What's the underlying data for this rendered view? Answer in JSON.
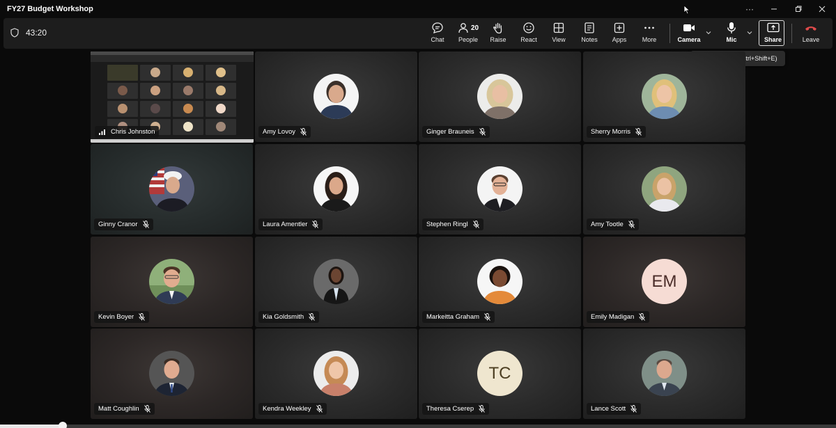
{
  "window": {
    "title": "FY27 Budget Workshop"
  },
  "toolbar": {
    "timer": "43:20",
    "chat_label": "Chat",
    "people_label": "People",
    "people_count": "20",
    "raise_label": "Raise",
    "react_label": "React",
    "view_label": "View",
    "notes_label": "Notes",
    "apps_label": "Apps",
    "more_label": "More",
    "camera_label": "Camera",
    "mic_label": "Mic",
    "share_label": "Share",
    "leave_label": "Leave",
    "leave_color": "#e04b4b"
  },
  "tooltip": {
    "text": "Share content (Ctrl+Shift+E)"
  },
  "shared_screen": {
    "presenter": "Chris Johnston"
  },
  "participants": [
    {
      "name": "Amy Lovoy"
    },
    {
      "name": "Ginger Brauneis"
    },
    {
      "name": "Sherry Morris"
    },
    {
      "name": "Ginny Cranor"
    },
    {
      "name": "Laura Amentler"
    },
    {
      "name": "Stephen Ringl"
    },
    {
      "name": "Amy Tootle"
    },
    {
      "name": "Kevin Boyer"
    },
    {
      "name": "Kia Goldsmith"
    },
    {
      "name": "Markeitta Graham"
    },
    {
      "name": "Emily Madigan",
      "initials": "EM"
    },
    {
      "name": "Matt Coughlin"
    },
    {
      "name": "Kendra Weekley"
    },
    {
      "name": "Theresa Cserep",
      "initials": "TC"
    },
    {
      "name": "Lance Scott"
    }
  ],
  "playback": {
    "progress": 0.075
  }
}
